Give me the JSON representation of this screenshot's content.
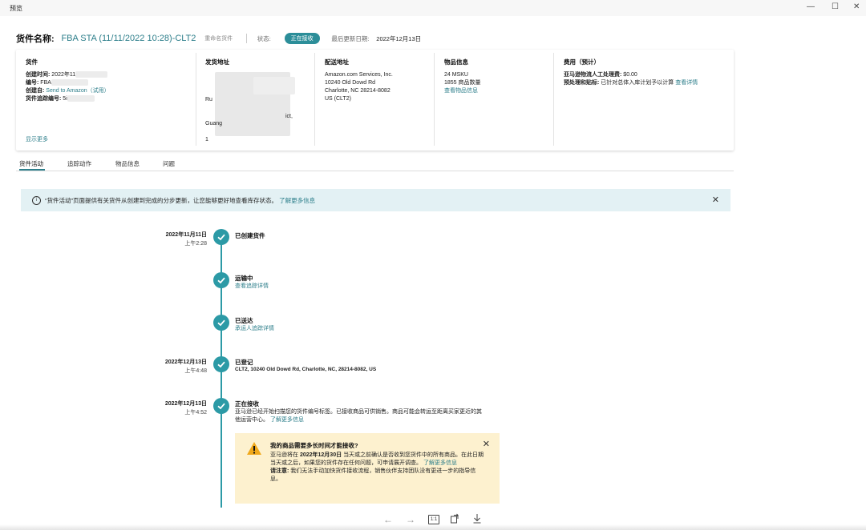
{
  "window": {
    "title": "预览",
    "minimize": "—",
    "maximize": "☐",
    "close": "✕"
  },
  "header": {
    "label": "货件名称:",
    "name": "FBA STA (11/11/2022 10:28)-CLT2",
    "rename": "重命名货件",
    "status_label": "状态:",
    "status_value": "正在接收",
    "updated_label": "最后更新日期:",
    "updated_value": "2022年12月13日"
  },
  "card": {
    "shipment": {
      "title": "货件",
      "created_label": "创建时间:",
      "created_value": "2022年11",
      "id_label": "编号:",
      "id_value": "FBA",
      "creator_label": "创建自:",
      "creator_value": "Send to Amazon（试用）",
      "tracking_label": "货件追踪编号:",
      "tracking_value": "5i",
      "show_more": "显示更多"
    },
    "from": {
      "title": "发货地址",
      "line1": "ace",
      "line2": "Ru",
      "line3": "ict,",
      "line4": "Guang",
      "line5": "1"
    },
    "to": {
      "title": "配送地址",
      "lines": [
        "Amazon.com Services, Inc.",
        "10240 Old Dowd Rd",
        "Charlotte, NC 28214-8082",
        "US (CLT2)"
      ]
    },
    "items": {
      "title": "物品信息",
      "msku": "24 MSKU",
      "qty": "1855 商品数量",
      "link": "查看物品信息"
    },
    "fees": {
      "title": "费用（预计）",
      "manual_label": "亚马逊物流人工处理费:",
      "manual_value": "$0.00",
      "prep_label": "预处理和贴标:",
      "prep_value": "已针对总体入库计划予以计算",
      "prep_link": "查看详情"
    }
  },
  "tabs": [
    "货件活动",
    "追踪动作",
    "物品信息",
    "问题"
  ],
  "banner": {
    "text": "“货件活动”页面提供有关货件从创建到完成的分步更新，让您能够更好地查看库存状态。",
    "link": "了解更多信息",
    "close": "✕"
  },
  "timeline": [
    {
      "date": "2022年11月11日",
      "time": "上午2:28",
      "title": "已创建货件",
      "sub": ""
    },
    {
      "date": "",
      "time": "",
      "title": "运输中",
      "sub": "查看追踪详情"
    },
    {
      "date": "",
      "time": "",
      "title": "已送达",
      "sub": "承运人追踪详情"
    },
    {
      "date": "2022年12月13日",
      "time": "上午4:48",
      "title": "已登记",
      "sub": "CLT2, 10240 Old Dowd Rd, Charlotte, NC, 28214-8082, US"
    },
    {
      "date": "2022年12月13日",
      "time": "上午4:52",
      "title": "正在接收",
      "text1": "亚马逊已经开始扫描您的货件编号标签。已接收商品可供销售。商品可能会转运至距离买家更近的其",
      "text2": "他运营中心。",
      "link": "了解更多信息"
    }
  ],
  "warning": {
    "title": "我的商品需要多长时间才能接收?",
    "p1_pre": "亚马逊将在",
    "p1_date": "2022年12月30日",
    "p1_post": "当天或之前确认是否收到您货件中的所有商品。在此日期当天或之后，如果您的货件存在任何问题，可申请展开调查。",
    "p1_link": "了解更多信息",
    "note_label": "请注意:",
    "note_text": "我们无法手动加快货件接收流程，销售伙伴支持团队没有更进一步的指导信息。",
    "close": "✕"
  },
  "bottom": {
    "ratio": "1:1"
  }
}
